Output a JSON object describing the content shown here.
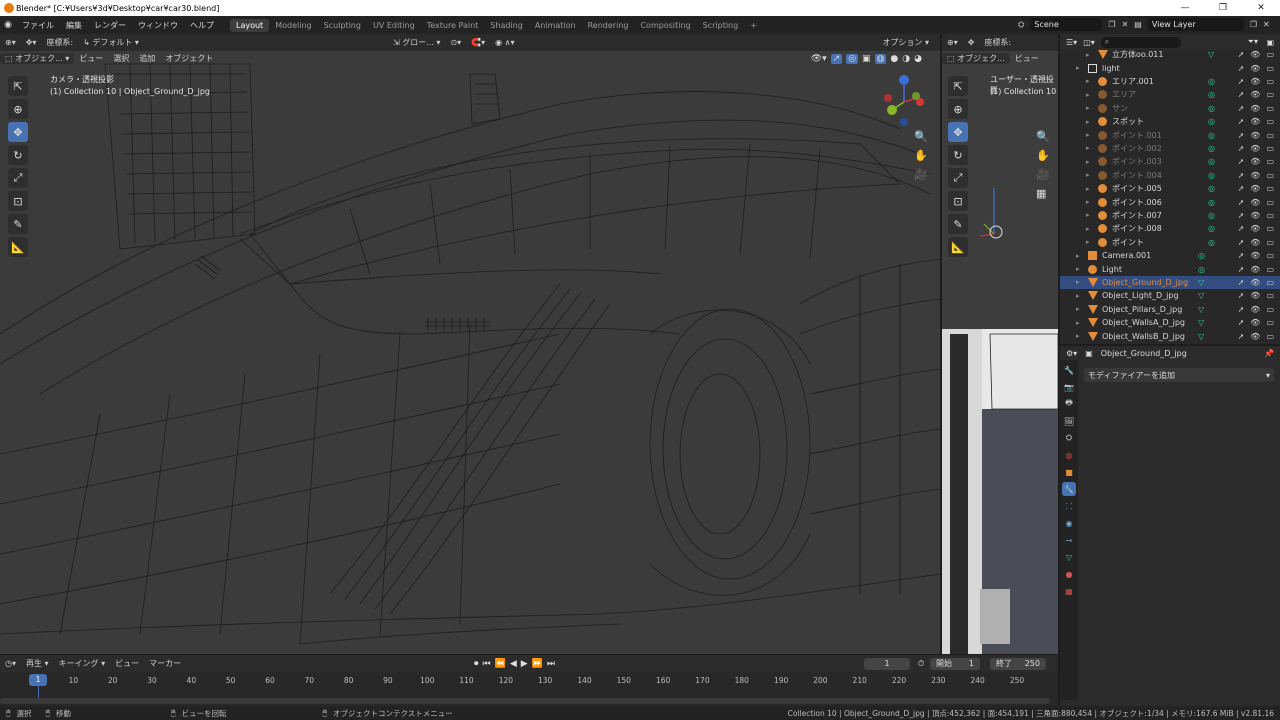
{
  "window": {
    "title": "Blender* [C:¥Users¥3d¥Desktop¥car¥car30.blend]",
    "buttons": [
      "—",
      "❐",
      "✕"
    ]
  },
  "menu": [
    "ファイル",
    "編集",
    "レンダー",
    "ウィンドウ",
    "ヘルプ"
  ],
  "workspaces": [
    "Layout",
    "Modeling",
    "Sculpting",
    "UV Editing",
    "Texture Paint",
    "Shading",
    "Animation",
    "Rendering",
    "Compositing",
    "Scripting"
  ],
  "add_workspace": "+",
  "scene": {
    "label": "Scene",
    "view_layer": "View Layer"
  },
  "viewport_main": {
    "header": {
      "orientation_label": "座標系:",
      "orientation": "デフォルト",
      "transform": "グロー...",
      "options": "オプション"
    },
    "menus": [
      "オブジェク...",
      "ビュー",
      "選択",
      "追加",
      "オブジェクト"
    ],
    "overlay_title": "カメラ・透視投影",
    "overlay_subtitle": "(1) Collection 10 | Object_Ground_D_jpg"
  },
  "viewport_side": {
    "header": {
      "orientation_label": "座標系:"
    },
    "menus": [
      "オブジェク...",
      "ビュー"
    ],
    "overlay_title": "ユーザー・透視投影",
    "overlay_subtitle": "(1) Collection 10"
  },
  "outliner": {
    "search_placeholder": "",
    "rows": [
      {
        "name": "立方体oo.011",
        "kind": "mesh",
        "indent": 2,
        "state": "normal"
      },
      {
        "name": "light",
        "kind": "collection",
        "indent": 1,
        "state": "normal"
      },
      {
        "name": "エリア.001",
        "kind": "light",
        "indent": 2,
        "state": "normal"
      },
      {
        "name": "エリア",
        "kind": "light",
        "indent": 2,
        "state": "dim"
      },
      {
        "name": "サン",
        "kind": "light",
        "indent": 2,
        "state": "dim"
      },
      {
        "name": "スポット",
        "kind": "light",
        "indent": 2,
        "state": "normal"
      },
      {
        "name": "ポイント.001",
        "kind": "light",
        "indent": 2,
        "state": "dim"
      },
      {
        "name": "ポイント.002",
        "kind": "light",
        "indent": 2,
        "state": "dim"
      },
      {
        "name": "ポイント.003",
        "kind": "light",
        "indent": 2,
        "state": "dim"
      },
      {
        "name": "ポイント.004",
        "kind": "light",
        "indent": 2,
        "state": "dim"
      },
      {
        "name": "ポイント.005",
        "kind": "light",
        "indent": 2,
        "state": "normal"
      },
      {
        "name": "ポイント.006",
        "kind": "light",
        "indent": 2,
        "state": "normal"
      },
      {
        "name": "ポイント.007",
        "kind": "light",
        "indent": 2,
        "state": "normal"
      },
      {
        "name": "ポイント.008",
        "kind": "light",
        "indent": 2,
        "state": "normal"
      },
      {
        "name": "ポイント",
        "kind": "light",
        "indent": 2,
        "state": "normal"
      },
      {
        "name": "Camera.001",
        "kind": "camera",
        "indent": 1,
        "state": "normal"
      },
      {
        "name": "Light",
        "kind": "light",
        "indent": 1,
        "state": "normal"
      },
      {
        "name": "Object_Ground_D_jpg",
        "kind": "mesh",
        "indent": 1,
        "state": "selected"
      },
      {
        "name": "Object_Light_D_jpg",
        "kind": "mesh",
        "indent": 1,
        "state": "normal"
      },
      {
        "name": "Object_Pillars_D_jpg",
        "kind": "mesh",
        "indent": 1,
        "state": "normal"
      },
      {
        "name": "Object_WallsA_D_jpg",
        "kind": "mesh",
        "indent": 1,
        "state": "normal"
      },
      {
        "name": "Object_WallsB_D_jpg",
        "kind": "mesh",
        "indent": 1,
        "state": "normal"
      }
    ]
  },
  "properties": {
    "object_name": "Object_Ground_D_jpg",
    "add_modifier": "モディファイアーを追加"
  },
  "timeline": {
    "menus": [
      "再生",
      "キーイング",
      "ビュー",
      "マーカー"
    ],
    "current_frame": "1",
    "start_label": "開始",
    "start": "1",
    "end_label": "終了",
    "end": "250",
    "ticks": [
      "1",
      "10",
      "20",
      "30",
      "40",
      "50",
      "60",
      "70",
      "80",
      "90",
      "100",
      "110",
      "120",
      "130",
      "140",
      "150",
      "160",
      "170",
      "180",
      "190",
      "200",
      "210",
      "220",
      "230",
      "240",
      "250"
    ]
  },
  "statusbar": {
    "select": "選択",
    "move": "移動",
    "rotate": "ビューを回転",
    "context_menu": "オブジェクトコンテクストメニュー",
    "info": "Collection 10 | Object_Ground_D_jpg | 頂点:452,362 | 面:454,191 | 三角面:880,454 | オブジェクト:1/34 | メモリ:167.6 MiB | v2.81.16"
  },
  "colors": {
    "accent": "#4772b3",
    "selected_row": "#334d80",
    "mesh_icon": "#e38c3a",
    "light_icon": "#47b08f"
  }
}
